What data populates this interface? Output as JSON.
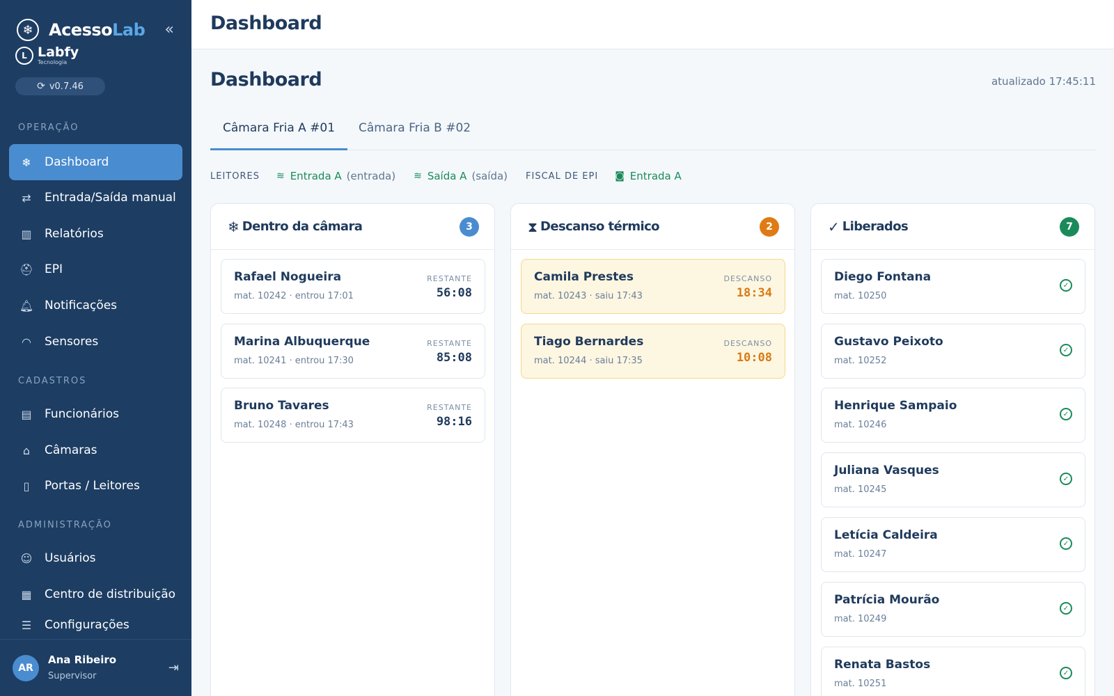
{
  "app": {
    "brand_main": "Acesso",
    "brand_accent": "Lab",
    "company_name": "Labfy",
    "company_sub": "Tecnologia",
    "version": "v0.7.46"
  },
  "sidebar": {
    "sections": {
      "operacao": "OPERAÇÃO",
      "cadastros": "CADASTROS",
      "administracao": "ADMINISTRAÇÃO"
    },
    "items": [
      {
        "label": "Dashboard",
        "icon": "snowflake-icon",
        "active": true
      },
      {
        "label": "Entrada/Saída manual",
        "icon": "swap-arrows-icon"
      },
      {
        "label": "Relatórios",
        "icon": "bar-chart-icon"
      },
      {
        "label": "EPI",
        "icon": "helmet-icon"
      },
      {
        "label": "Notificações",
        "icon": "bell-icon"
      },
      {
        "label": "Sensores",
        "icon": "wifi-icon"
      },
      {
        "label": "Funcionários",
        "icon": "id-card-icon"
      },
      {
        "label": "Câmaras",
        "icon": "warehouse-icon"
      },
      {
        "label": "Portas / Leitores",
        "icon": "door-icon"
      },
      {
        "label": "Usuários",
        "icon": "users-icon"
      },
      {
        "label": "Centro de distribuição",
        "icon": "building-icon"
      },
      {
        "label": "Configurações",
        "icon": "sliders-icon"
      }
    ],
    "user": {
      "initials": "AR",
      "name": "Ana Ribeiro",
      "role": "Supervisor"
    }
  },
  "topbar": {
    "title": "Dashboard"
  },
  "main": {
    "title": "Dashboard",
    "updated": "atualizado 17:45:11",
    "tabs": [
      {
        "label": "Câmara Fria A #01",
        "active": true
      },
      {
        "label": "Câmara Fria B #02"
      }
    ],
    "readers": {
      "label": "LEITORES",
      "items": [
        {
          "name": "Entrada A",
          "direction": "(entrada)"
        },
        {
          "name": "Saída A",
          "direction": "(saída)"
        }
      ],
      "fiscal_label": "FISCAL DE EPI",
      "fiscal": "Entrada A"
    },
    "columns": {
      "inside": {
        "title": "Dentro da câmara",
        "count": "3",
        "color": "#4a8cd0",
        "time_label": "RESTANTE",
        "cards": [
          {
            "name": "Rafael Nogueira",
            "meta": "mat. 10242 · entrou 17:01",
            "time": "56:08"
          },
          {
            "name": "Marina Albuquerque",
            "meta": "mat. 10241 · entrou 17:30",
            "time": "85:08"
          },
          {
            "name": "Bruno Tavares",
            "meta": "mat. 10248 · entrou 17:43",
            "time": "98:16"
          }
        ]
      },
      "rest": {
        "title": "Descanso térmico",
        "count": "2",
        "color": "#e07a14",
        "time_label": "DESCANSO",
        "cards": [
          {
            "name": "Camila Prestes",
            "meta": "mat. 10243 · saiu 17:43",
            "time": "18:34"
          },
          {
            "name": "Tiago Bernardes",
            "meta": "mat. 10244 · saiu 17:35",
            "time": "10:08"
          }
        ]
      },
      "released": {
        "title": "Liberados",
        "count": "7",
        "color": "#1b8a5a",
        "cards": [
          {
            "name": "Diego Fontana",
            "meta": "mat. 10250"
          },
          {
            "name": "Gustavo Peixoto",
            "meta": "mat. 10252"
          },
          {
            "name": "Henrique Sampaio",
            "meta": "mat. 10246"
          },
          {
            "name": "Juliana Vasques",
            "meta": "mat. 10245"
          },
          {
            "name": "Letícia Caldeira",
            "meta": "mat. 10247"
          },
          {
            "name": "Patrícia Mourão",
            "meta": "mat. 10249"
          },
          {
            "name": "Renata Bastos",
            "meta": "mat. 10251"
          }
        ]
      }
    }
  }
}
